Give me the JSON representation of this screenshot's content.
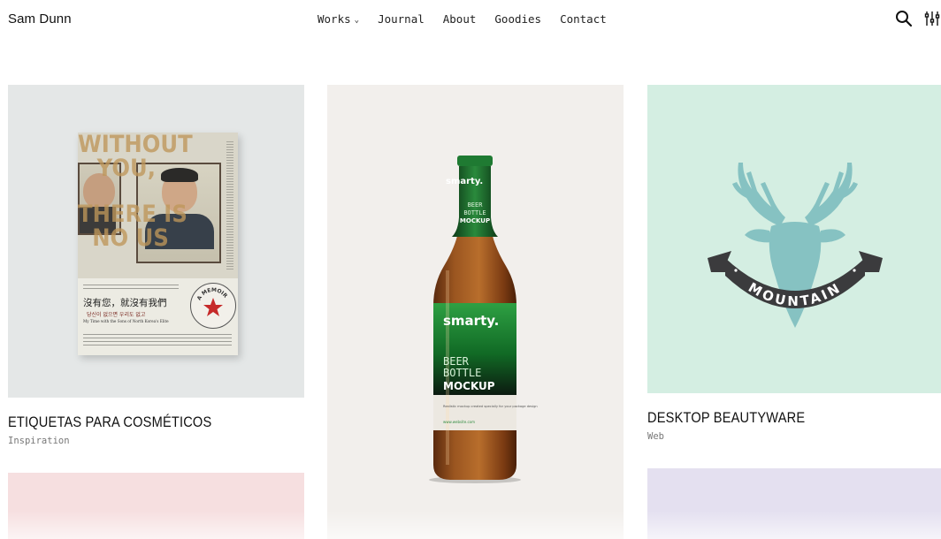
{
  "header": {
    "brand": "Sam Dunn",
    "nav": [
      {
        "label": "Works",
        "has_dropdown": true
      },
      {
        "label": "Journal"
      },
      {
        "label": "About"
      },
      {
        "label": "Goodies"
      },
      {
        "label": "Contact"
      }
    ],
    "search_icon": "search-icon",
    "filter_icon": "sliders-icon"
  },
  "cards": [
    {
      "title": "ETIQUETAS PARA COSMÉTICOS",
      "category": "Inspiration",
      "bg": "#e4e7e7"
    },
    {
      "title": "",
      "category": "",
      "bg": "#f2efec"
    },
    {
      "title": "DESKTOP BEAUTYWARE",
      "category": "Web",
      "bg": "#d4eee2"
    },
    {
      "bg": "#f6dfe0"
    },
    {
      "bg": "#e4e0f0"
    }
  ],
  "book": {
    "title_lines": [
      "WITHOUT",
      "YOU,",
      "THERE IS",
      "NO US"
    ],
    "chinese_title": "沒有您，就沒有我們",
    "korean_line": "당신이 없으면 우리도 없고",
    "subtitle": "My Time with the Sons of North Korea's Elite",
    "badge": "A MEMOIR"
  },
  "bottle": {
    "brand": "smarty.",
    "neck_lines": [
      "BEER",
      "BOTTLE",
      "MOCKUP"
    ],
    "label_lines": [
      "BEER",
      "BOTTLE",
      "MOCKUP"
    ],
    "small_text": "Realistic mockup created specially for your package design",
    "url": "www.website.com"
  },
  "deer": {
    "ribbon_text": "MOUNTAIN"
  }
}
